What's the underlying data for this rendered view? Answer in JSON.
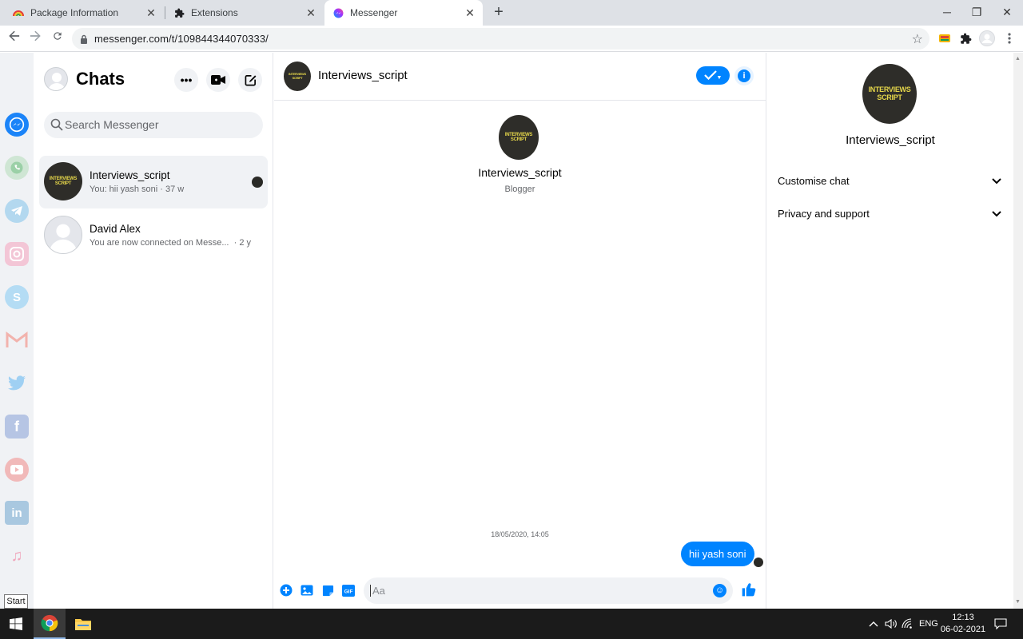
{
  "browser": {
    "tabs": [
      {
        "label": "Package Information",
        "icon": "rainbow-icon",
        "active": false
      },
      {
        "label": "Extensions",
        "icon": "puzzle-icon",
        "active": false
      },
      {
        "label": "Messenger",
        "icon": "messenger-icon",
        "active": true
      }
    ],
    "url": "messenger.com/t/109844344070333/"
  },
  "app_strip": {
    "items": [
      "messenger",
      "whatsapp",
      "telegram",
      "instagram",
      "skype",
      "gmail",
      "twitter",
      "facebook",
      "youtube",
      "linkedin",
      "music"
    ],
    "start_tooltip": "Start"
  },
  "sidebar": {
    "title": "Chats",
    "search_placeholder": "Search Messenger",
    "conversations": [
      {
        "name": "Interviews_script",
        "preview": "You: hii yash soni · 37 w",
        "active": true
      },
      {
        "name": "David Alex",
        "preview": "You are now connected on Messe...",
        "time": "· 2 y",
        "active": false
      }
    ]
  },
  "conversation": {
    "name": "Interviews_script",
    "intro_name": "Interviews_script",
    "intro_subtitle": "Blogger",
    "timestamp": "18/05/2020, 14:05",
    "messages": [
      {
        "text": "hii yash soni",
        "from": "me"
      }
    ],
    "composer_placeholder": "Aa",
    "avatar_text": "INTERVIEWS SCRIPT"
  },
  "info_panel": {
    "name": "Interviews_script",
    "sections": [
      "Customise chat",
      "Privacy and support"
    ]
  },
  "taskbar": {
    "language": "ENG",
    "time": "12:13",
    "date": "06-02-2021"
  },
  "colors": {
    "accent": "#0084ff",
    "logo_bg": "#2e2d29",
    "logo_text": "#e5d64a"
  }
}
